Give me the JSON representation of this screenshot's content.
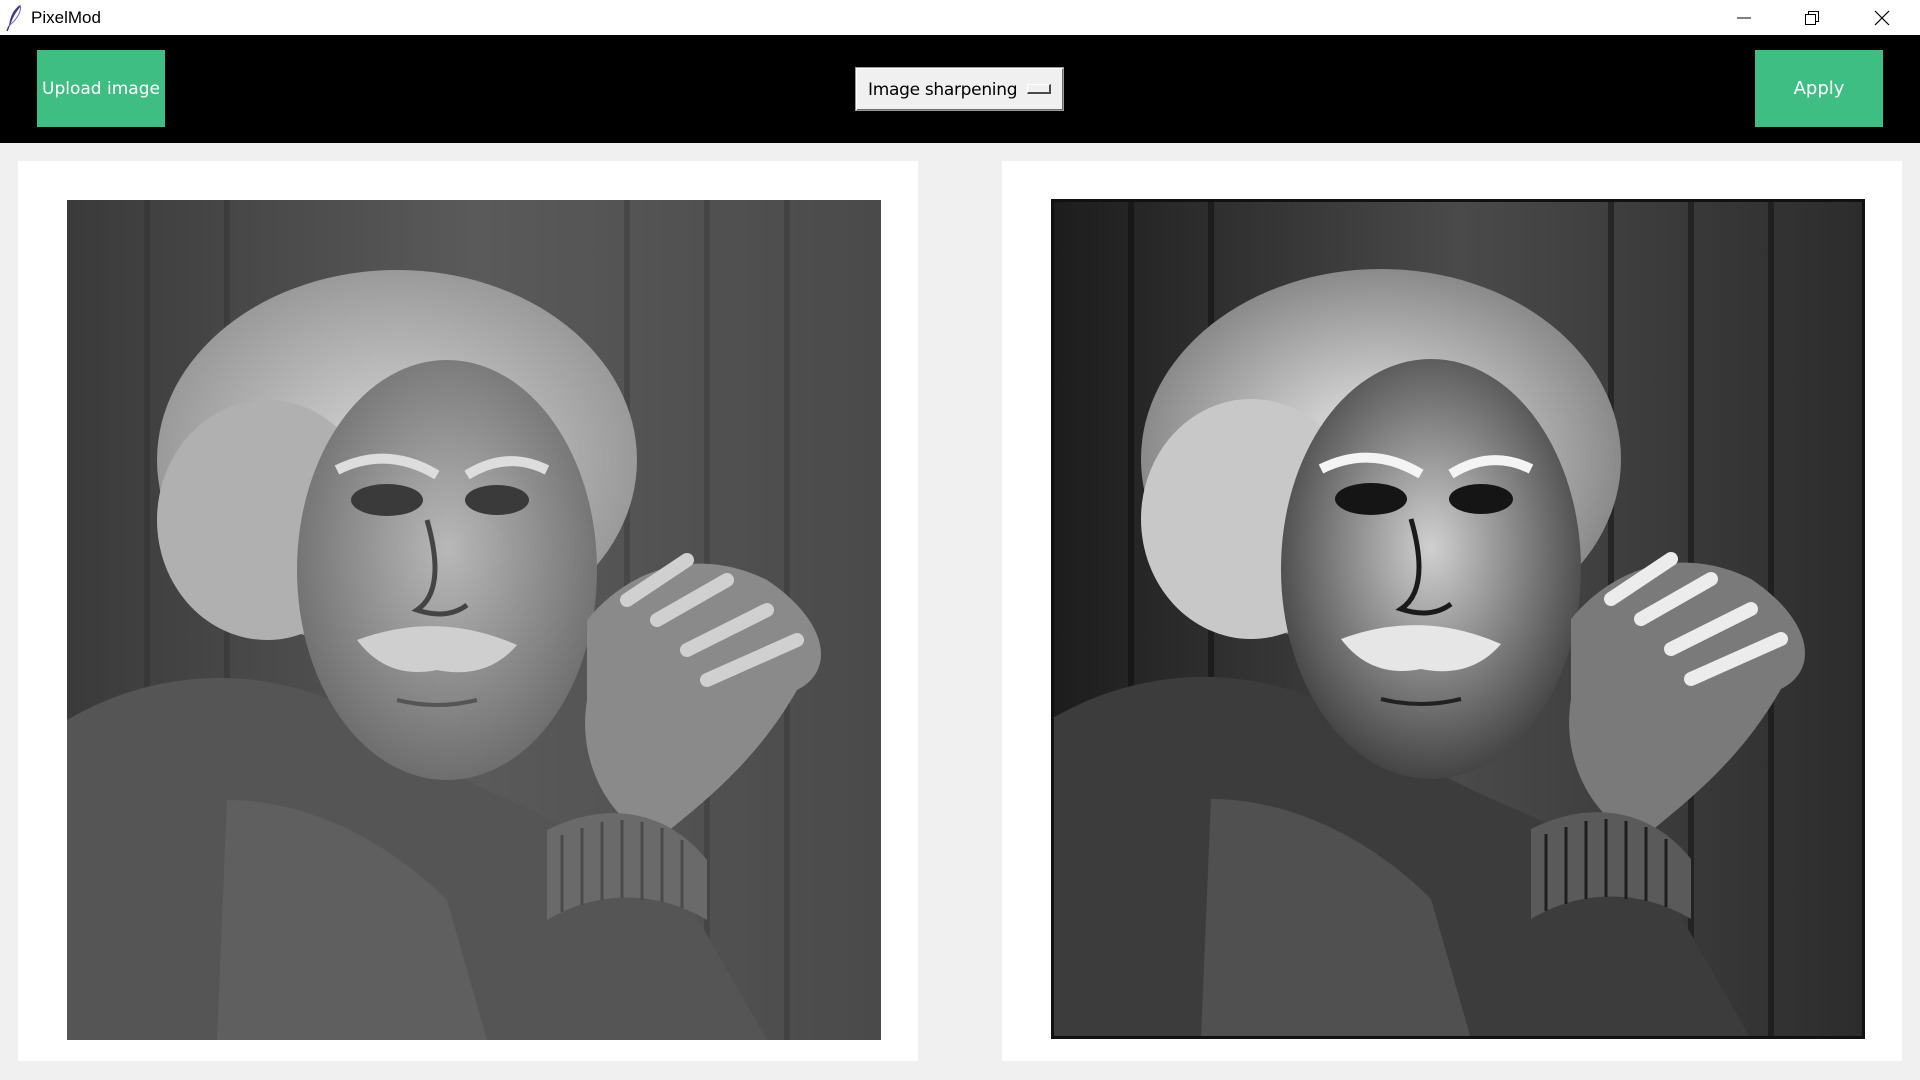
{
  "window": {
    "title": "PixelMod",
    "app_icon": "feather-icon",
    "controls": [
      "minimize-icon",
      "restore-icon",
      "close-icon"
    ]
  },
  "toolbar": {
    "upload_label": "Upload image",
    "filter_selected": "Image sharpening",
    "apply_label": "Apply",
    "accent_color": "#3ebe82",
    "background_color": "#000000"
  },
  "images": {
    "original_description": "original-photo",
    "processed_description": "sharpened-photo"
  }
}
